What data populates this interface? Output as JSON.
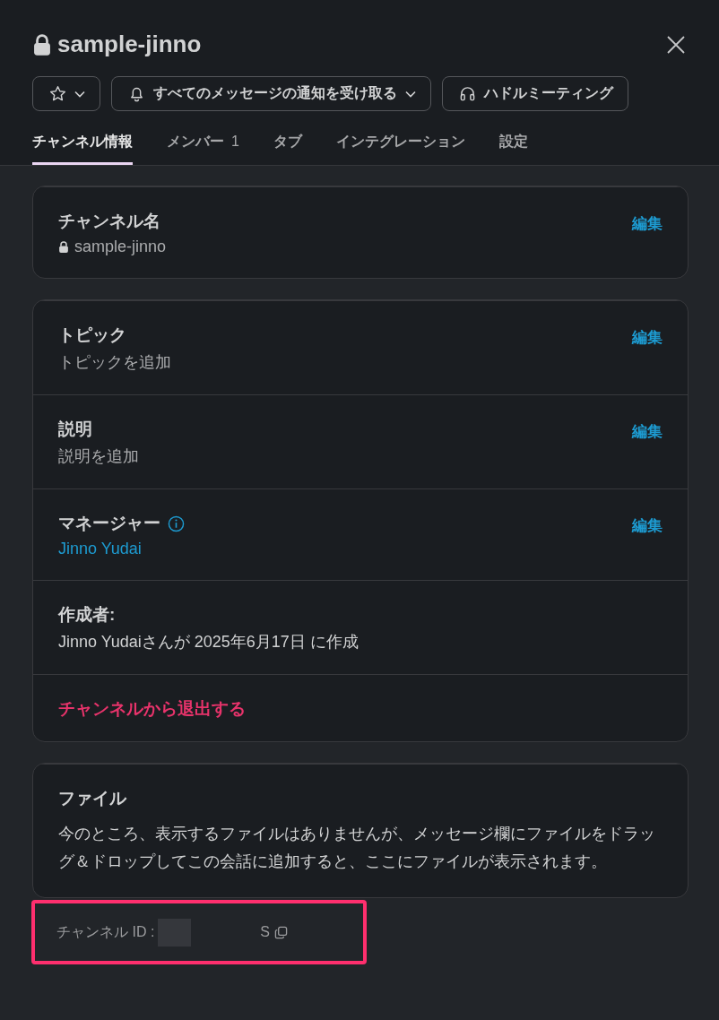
{
  "header": {
    "title": "sample-jinno",
    "private": true,
    "buttons": [
      {
        "kind": "star",
        "dropdown": true
      },
      {
        "kind": "bell",
        "label": "すべてのメッセージの通知を受け取る",
        "dropdown": true
      },
      {
        "kind": "headphones",
        "label": "ハドルミーティング",
        "dropdown": false
      }
    ],
    "tabs": [
      {
        "label": "チャンネル情報",
        "selected": true
      },
      {
        "label": "メンバー",
        "count": "1",
        "selected": false
      },
      {
        "label": "タブ",
        "selected": false
      },
      {
        "label": "インテグレーション",
        "selected": false
      },
      {
        "label": "設定",
        "selected": false
      }
    ]
  },
  "cards": [
    {
      "rows": [
        {
          "kind": "field",
          "label": "チャンネル名",
          "value": "sample-jinno",
          "private": true,
          "action": "編集"
        }
      ]
    },
    {
      "rows": [
        {
          "kind": "field",
          "label": "トピック",
          "value": "トピックを追加",
          "action": "編集"
        },
        {
          "kind": "field",
          "label": "説明",
          "value": "説明を追加",
          "action": "編集"
        },
        {
          "kind": "field",
          "label": "マネージャー",
          "info": true,
          "value": "Jinno Yudai",
          "link": true,
          "action": "編集"
        },
        {
          "kind": "field",
          "label": "作成者:",
          "value": "Jinno Yudaiさんが 2025年6月17日 に作成",
          "plain": true
        },
        {
          "kind": "danger",
          "label": "チャンネルから退出する"
        }
      ]
    },
    {
      "rows": [
        {
          "kind": "text",
          "label": "ファイル",
          "value": "今のところ、表示するファイルはありませんが、メッセージ欄にファイルをドラッグ＆ドロップしてこの会話に追加すると、ここにファイルが表示されます。"
        }
      ]
    }
  ],
  "footer": {
    "label": "チャンネル ID :",
    "redacted": true,
    "value": "S",
    "highlighted": true
  }
}
